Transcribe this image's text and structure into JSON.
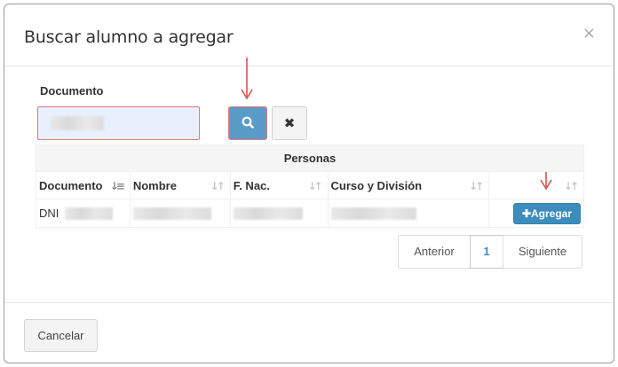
{
  "modal": {
    "title": "Buscar alumno a agregar",
    "close_glyph": "×"
  },
  "search": {
    "label": "Documento",
    "value": "",
    "search_icon": "search-icon",
    "clear_glyph": "✖"
  },
  "table": {
    "caption": "Personas",
    "columns": [
      "Documento",
      "Nombre",
      "F. Nac.",
      "Curso y División",
      ""
    ],
    "rows": [
      {
        "documento_prefix": "DNI",
        "action_label": "Agregar"
      }
    ]
  },
  "pagination": {
    "prev": "Anterior",
    "current": "1",
    "next": "Siguiente"
  },
  "footer": {
    "cancel": "Cancelar"
  },
  "colors": {
    "primary": "#3c8dbc",
    "search_button": "#5b9bc8",
    "annotation": "#e07a7a"
  }
}
